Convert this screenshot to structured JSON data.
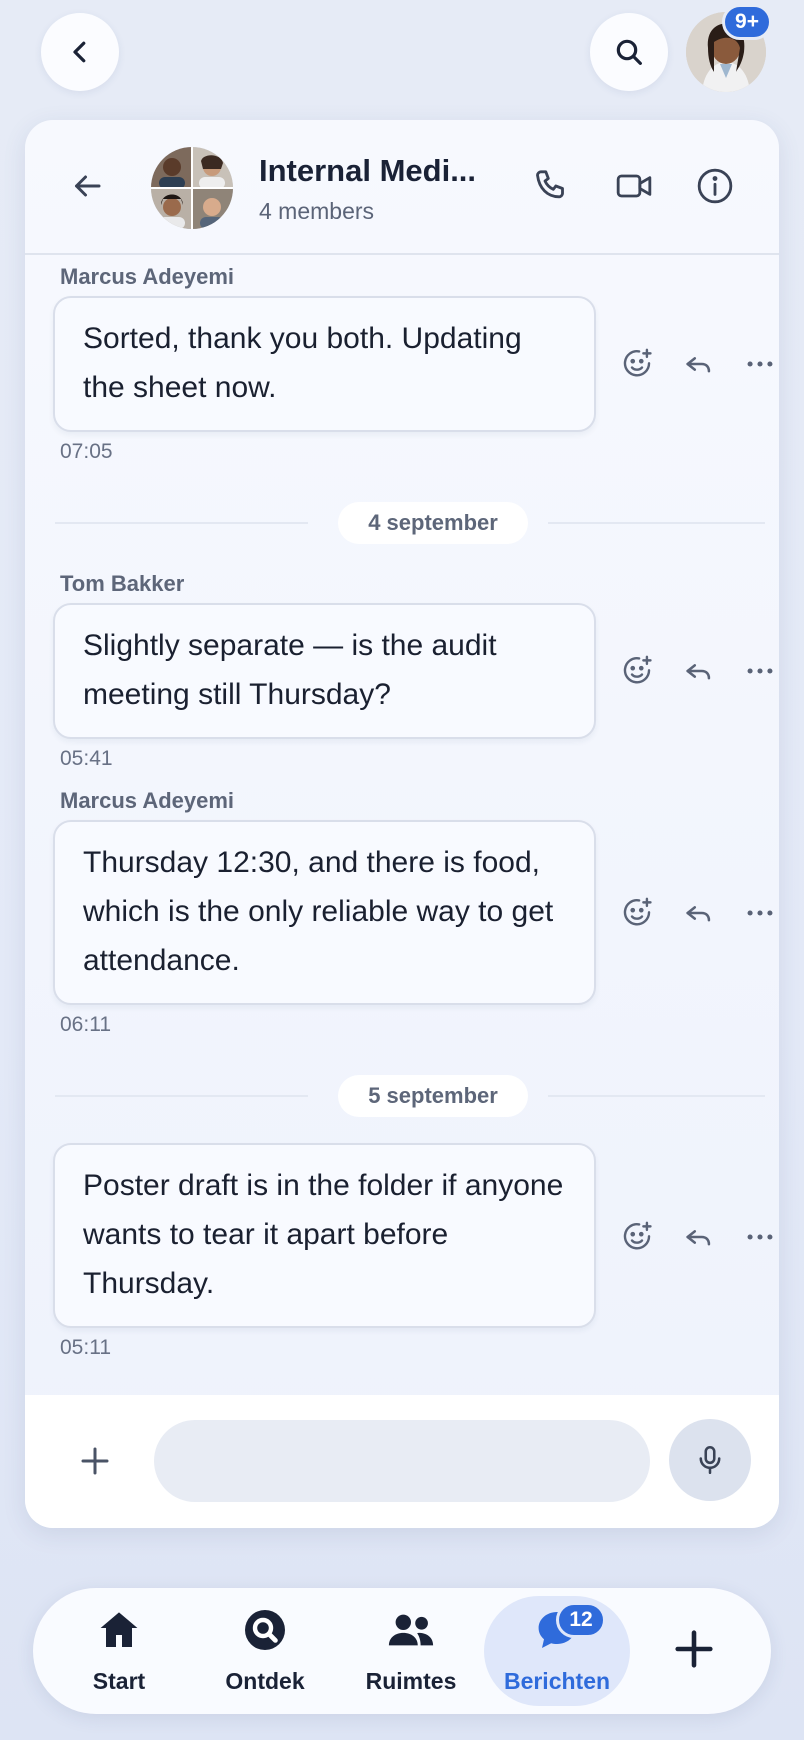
{
  "top": {
    "notification_count": "9+"
  },
  "chat": {
    "title": "Internal Medi...",
    "subtitle": "4 members"
  },
  "messages": [
    {
      "sender": "Marcus Adeyemi",
      "text": "Sorted, thank you both. Updating the sheet now.",
      "time": "07:05"
    },
    {
      "date_separator": "4 september"
    },
    {
      "sender": "Tom Bakker",
      "text": "Slightly separate — is the audit meeting still Thursday?",
      "time": "05:41"
    },
    {
      "sender": "Marcus Adeyemi",
      "text": "Thursday 12:30, and there is food, which is the only reliable way to get attendance.",
      "time": "06:11"
    },
    {
      "date_separator": "5 september"
    },
    {
      "sender": "",
      "text": "Poster draft is in the folder if anyone wants to tear it apart before Thursday.",
      "time": "05:11"
    }
  ],
  "composer": {
    "placeholder": ""
  },
  "tabs": [
    {
      "label": "Start",
      "icon": "home-icon"
    },
    {
      "label": "Ontdek",
      "icon": "discover-icon"
    },
    {
      "label": "Ruimtes",
      "icon": "people-icon"
    },
    {
      "label": "Berichten",
      "icon": "chat-icon",
      "badge": "12",
      "active": true
    }
  ],
  "colors": {
    "accent": "#2f6bdb",
    "background": "#e6ebf6"
  }
}
